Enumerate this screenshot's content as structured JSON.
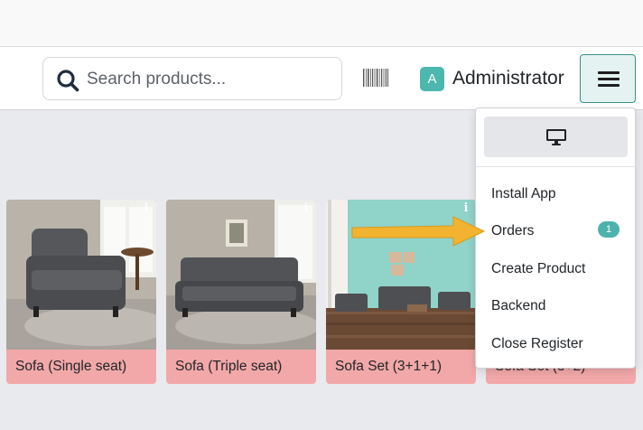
{
  "search": {
    "placeholder": "Search products..."
  },
  "user": {
    "initial": "A",
    "name": "Administrator"
  },
  "products": [
    {
      "name": "Sofa (Single seat)"
    },
    {
      "name": "Sofa (Triple seat)"
    },
    {
      "name": "Sofa Set (3+1+1)"
    },
    {
      "name": "Sofa Set (3+2)"
    }
  ],
  "menu": {
    "items": [
      {
        "label": "Install App"
      },
      {
        "label": "Orders",
        "badge": "1"
      },
      {
        "label": "Create Product"
      },
      {
        "label": "Backend"
      },
      {
        "label": "Close Register"
      }
    ]
  },
  "colors": {
    "accent": "#4db2ad",
    "card_footer": "#f2a8a8",
    "annotation_arrow": "#f2b430"
  },
  "icons": [
    "search-icon",
    "barcode-icon",
    "hamburger-menu-icon",
    "monitor-icon",
    "info-icon"
  ]
}
